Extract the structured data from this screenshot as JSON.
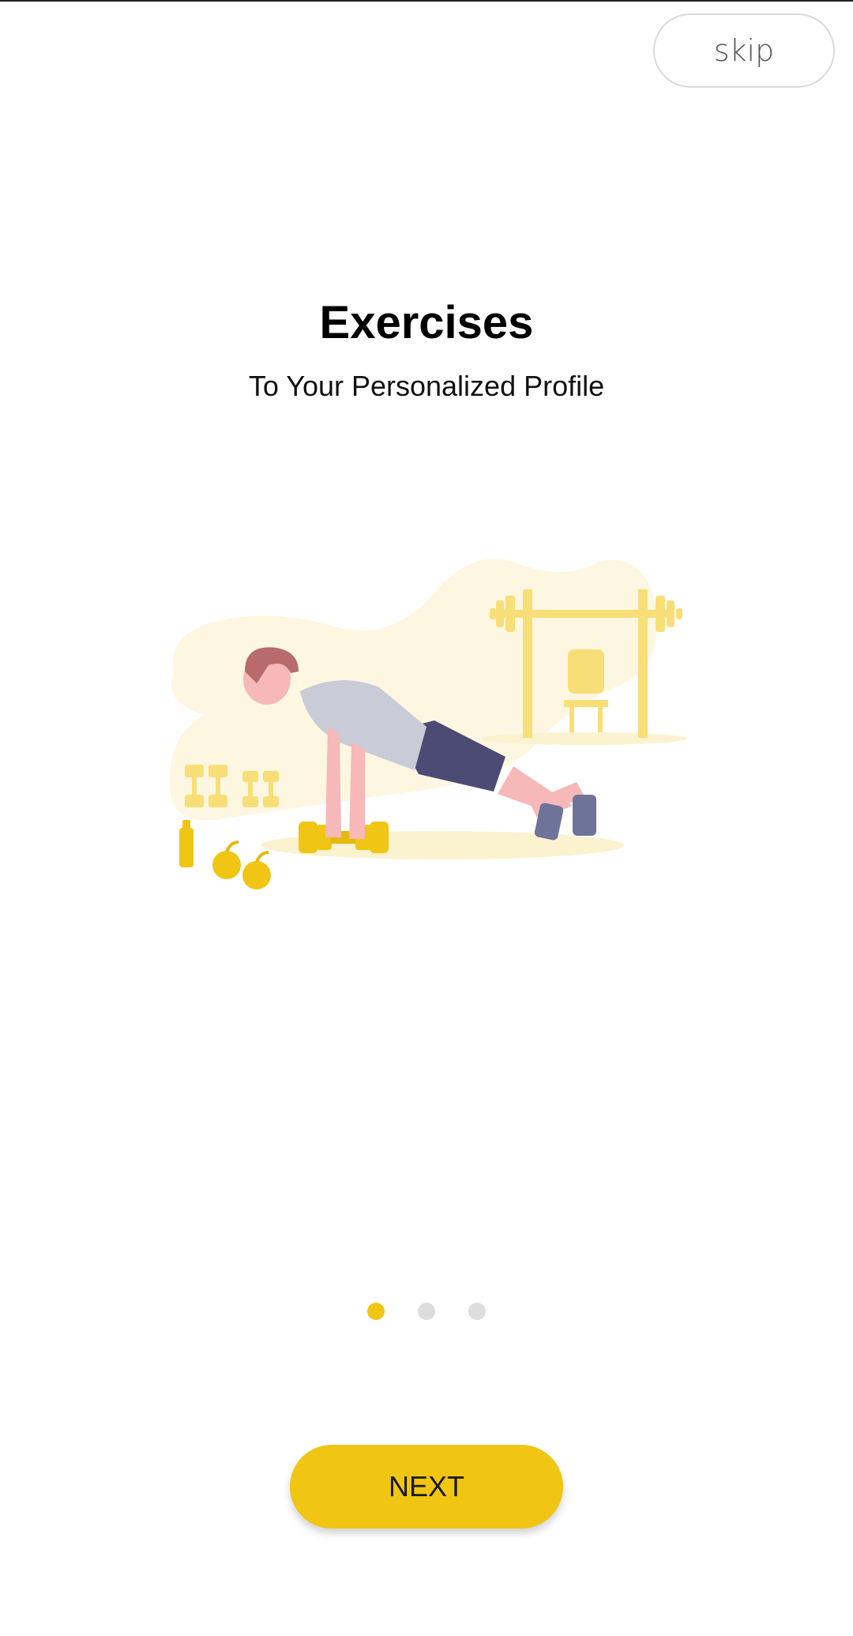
{
  "header": {
    "skip_label": "skip"
  },
  "onboarding": {
    "title": "Exercises",
    "subtitle": "To Your Personalized Profile",
    "illustration_icon": "push-up-workout-illustration"
  },
  "pager": {
    "total": 3,
    "current": 1
  },
  "footer": {
    "next_label": "NEXT"
  },
  "colors": {
    "accent": "#F0C514",
    "dot_inactive": "#DDDDDD",
    "illustration_blob": "#FDF7E2",
    "illustration_light": "#F8DE76"
  }
}
